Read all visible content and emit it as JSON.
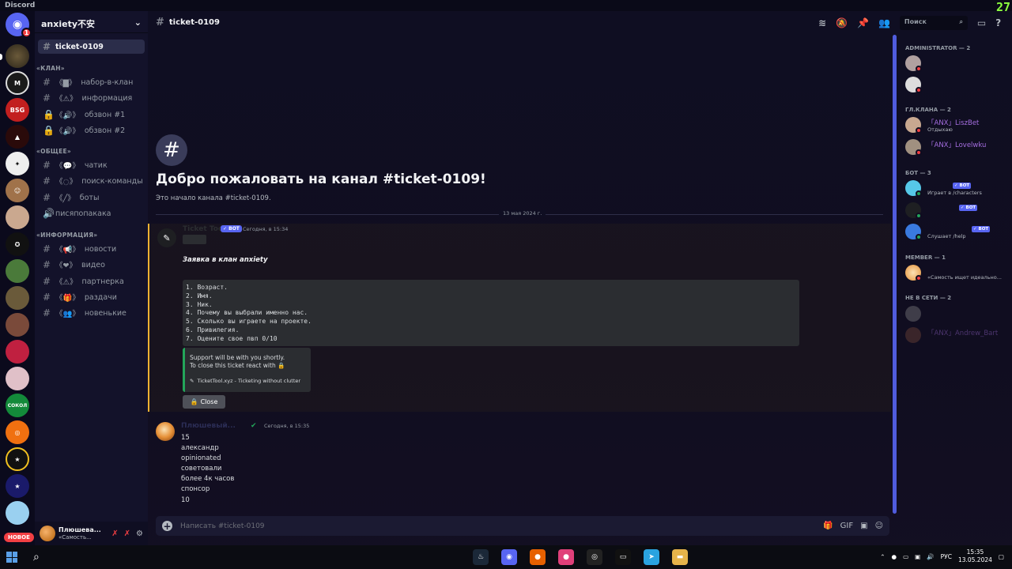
{
  "window": {
    "title": "Discord",
    "fps": "27"
  },
  "rail": {
    "new_badge": "НОВОЕ",
    "home_badge": "1",
    "servers": [
      "",
      "",
      "",
      "BSG",
      "",
      "",
      "",
      "",
      "",
      "",
      "",
      "",
      "",
      "СОКОЛ",
      "",
      "",
      "",
      "",
      ""
    ]
  },
  "server": {
    "name": "anxiety不安",
    "categories": [
      {
        "name": "«КЛАН»"
      },
      {
        "name": "«ОБЩЕЕ»"
      },
      {
        "name": "«ИНФОРМАЦИЯ»"
      }
    ],
    "channels": [
      {
        "label": "ticket-0109",
        "icon": "#",
        "active": true
      },
      {
        "label": "набор-в-клан",
        "icon": "#",
        "emoji": "《▇》"
      },
      {
        "label": "информация",
        "icon": "#",
        "emoji": "《⚠》"
      },
      {
        "label": "обзвон #1",
        "icon": "🔒",
        "emoji": "《🔊》"
      },
      {
        "label": "обзвон #2",
        "icon": "🔒",
        "emoji": "《🔊》"
      },
      {
        "label": "чатик",
        "icon": "#",
        "emoji": "《💬》"
      },
      {
        "label": "поиск-команды",
        "icon": "#",
        "emoji": "《◌》"
      },
      {
        "label": "боты",
        "icon": "#",
        "emoji": "《╱》"
      },
      {
        "label": "писяпопакака",
        "icon": "🔊"
      },
      {
        "label": "новости",
        "icon": "#",
        "emoji": "《📢》"
      },
      {
        "label": "видео",
        "icon": "#",
        "emoji": "《❤》"
      },
      {
        "label": "партнерка",
        "icon": "#",
        "emoji": "《⚠》"
      },
      {
        "label": "раздачи",
        "icon": "#",
        "emoji": "《🎁》"
      },
      {
        "label": "новенькие",
        "icon": "#",
        "emoji": "《👥》"
      }
    ]
  },
  "user": {
    "name": "Плюшева...",
    "status": "«Самость..."
  },
  "chat": {
    "channel": "ticket-0109",
    "search_placeholder": "Поиск",
    "welcome_title": "Добро пожаловать на канал #ticket-0109!",
    "welcome_sub": "Это начало канала #ticket-0109.",
    "date_divider": "13 мая 2024 г.",
    "msg1": {
      "author": "Ticket Tool",
      "tag": "✓ BOT",
      "time": "Сегодня, в 15:34",
      "title": "Заявка в клан anxiety",
      "code": [
        "1. Возраст.",
        "2. Имя.",
        "3. Ник.",
        "4. Почему вы выбрали именно нас.",
        "5. Сколько вы играете на проекте.",
        "6. Привилегия.",
        "7. Оцените свое пвп 0/10"
      ],
      "embed_line1": "Support will be with you shortly.",
      "embed_line2": "To close this ticket react with 🔒",
      "embed_footer": "TicketTool.xyz - Ticketing without clutter",
      "button": "Close"
    },
    "msg2": {
      "author": "Плюшевый...",
      "time": "Сегодня, в 15:35",
      "lines": [
        "15",
        "александр",
        "opinionated",
        "советовали",
        "более 4к часов",
        "спонсор",
        "10"
      ]
    },
    "input_placeholder": "Написать #ticket-0109"
  },
  "members": {
    "categories": [
      "ADMINISTRATOR — 2",
      "ГЛ.КЛАНА — 2",
      "БОТ — 3",
      "MEMBER — 1",
      "НЕ В СЕТИ — 2"
    ],
    "list": [
      {
        "name": "",
        "status": ""
      },
      {
        "name": "",
        "status": ""
      },
      {
        "name": "「ANX」LiszBet",
        "status": "Отдыхаю"
      },
      {
        "name": "「ANX」Lovelwku",
        "status": ""
      },
      {
        "name": "",
        "status": "Играет в /characters",
        "tag": "✓ BOT"
      },
      {
        "name": "",
        "status": "",
        "tag": "✓ BOT"
      },
      {
        "name": "",
        "status": "Слушает /help",
        "tag": "✓ BOT"
      },
      {
        "name": "",
        "status": "«Самость ищет идеально..."
      },
      {
        "name": "",
        "status": ""
      },
      {
        "name": "「ANX」Andrew_Bart",
        "status": ""
      }
    ]
  },
  "taskbar": {
    "lang": "РУС",
    "time": "15:35",
    "date": "13.05.2024"
  }
}
